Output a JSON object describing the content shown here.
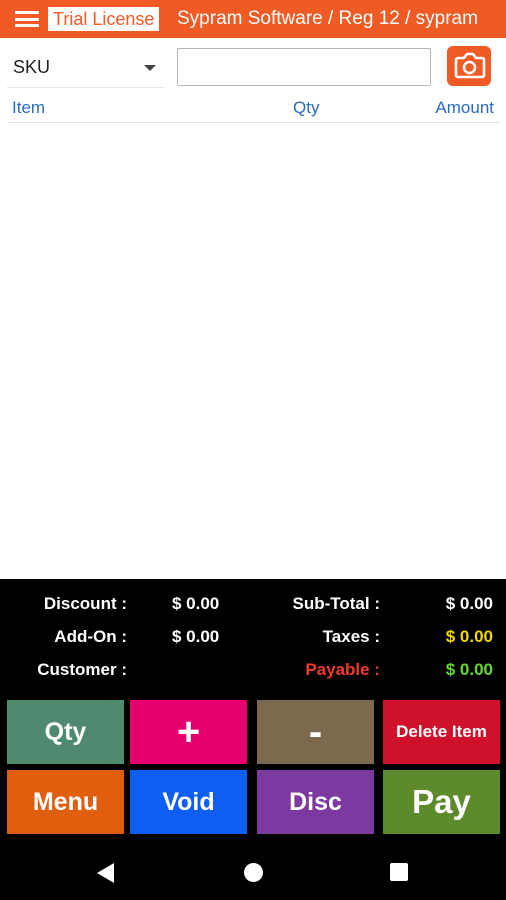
{
  "appbar": {
    "badge": "Trial License",
    "title": "Sypram Software / Reg 12 / sypram"
  },
  "search": {
    "selected_field": "SKU",
    "value": "",
    "placeholder": ""
  },
  "list": {
    "columns": [
      "Item",
      "Qty",
      "Amount"
    ],
    "rows": []
  },
  "totals": {
    "discount_label": "Discount :",
    "discount_value": "$ 0.00",
    "subtotal_label": "Sub-Total :",
    "subtotal_value": "$ 0.00",
    "addon_label": "Add-On :",
    "addon_value": "$ 0.00",
    "taxes_label": "Taxes :",
    "taxes_value": "$ 0.00",
    "customer_label": "Customer :",
    "payable_label": "Payable :",
    "payable_value": "$ 0.00"
  },
  "buttons": {
    "qty": "Qty",
    "plus": "+",
    "minus": "-",
    "delete_item": "Delete Item",
    "menu": "Menu",
    "void": "Void",
    "disc": "Disc",
    "pay": "Pay"
  },
  "colors": {
    "accent": "#f05a24",
    "column_header": "#2a6bc2",
    "btn_qty": "#4f8a70",
    "btn_plus": "#e6006e",
    "btn_minus": "#7d6a4e",
    "btn_delete": "#d0112b",
    "btn_menu": "#e05f0e",
    "btn_void": "#0f5ef4",
    "btn_disc": "#7c3aa0",
    "btn_pay": "#5d8a2b",
    "taxes_value": "#f2d600",
    "payable_label": "#f03a2a",
    "payable_value": "#66d92b"
  },
  "icons": {
    "menu": "hamburger-icon",
    "camera": "camera-icon",
    "dropdown": "chevron-down-icon",
    "nav_back": "back-triangle-icon",
    "nav_home": "home-circle-icon",
    "nav_recent": "recents-square-icon"
  }
}
